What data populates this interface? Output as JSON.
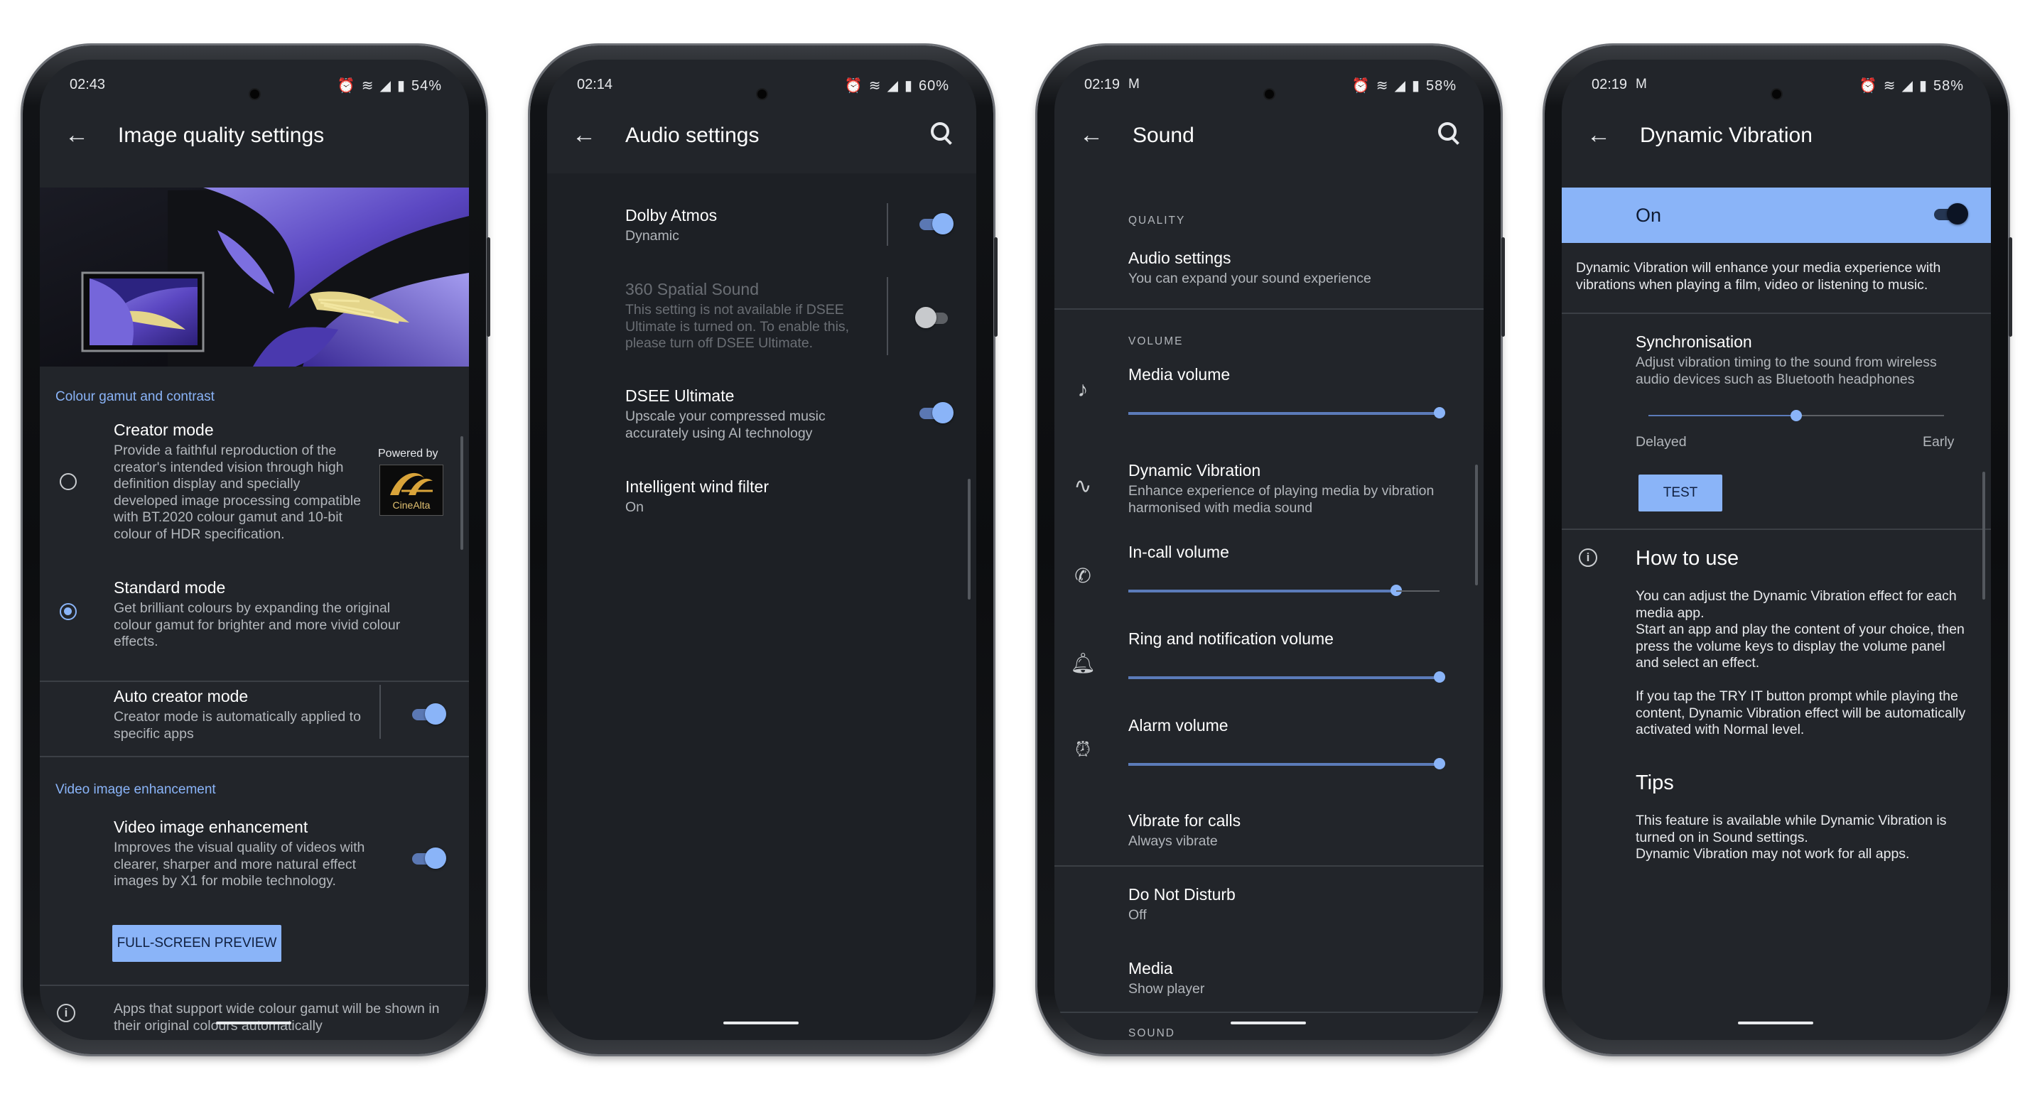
{
  "screens": [
    {
      "status": {
        "time": "02:43",
        "battery": "54%"
      },
      "title": "Image quality settings",
      "cat1": "Colour gamut and contrast",
      "creator_title": "Creator mode",
      "creator_desc": "Provide a faithful reproduction of the creator's intended vision through high definition display and specially developed image processing compatible with BT.2020 colour gamut and 10-bit colour of HDR specification.",
      "powered_by": "Powered by",
      "cinealta": "CineAlta",
      "standard_title": "Standard mode",
      "standard_desc": "Get brilliant colours by expanding the original colour gamut for brighter and more vivid colour effects.",
      "auto_title": "Auto creator mode",
      "auto_desc": "Creator mode is automatically applied to specific apps",
      "cat2": "Video image enhancement",
      "vie_title": "Video image enhancement",
      "vie_desc": "Improves the visual quality of videos with clearer, sharper and more natural effect images by X1 for mobile technology.",
      "preview_button": "FULL-SCREEN PREVIEW",
      "footer_note": "Apps that support wide colour gamut will be shown in their original colours automatically"
    },
    {
      "status": {
        "time": "02:14",
        "battery": "60%"
      },
      "title": "Audio settings",
      "dolby_title": "Dolby Atmos",
      "dolby_sub": "Dynamic",
      "spatial_title": "360 Spatial Sound",
      "spatial_desc": "This setting is not available if DSEE Ultimate is turned on. To enable this, please turn off DSEE Ultimate.",
      "dsee_title": "DSEE Ultimate",
      "dsee_desc": "Upscale your compressed music accurately using AI technology",
      "wind_title": "Intelligent wind filter",
      "wind_sub": "On"
    },
    {
      "status": {
        "time": "02:19",
        "battery": "58%"
      },
      "title": "Sound",
      "quality_cap": "QUALITY",
      "audio_title": "Audio settings",
      "audio_sub": "You can expand your sound experience",
      "volume_cap": "VOLUME",
      "media_vol": "Media volume",
      "dv_title": "Dynamic Vibration",
      "dv_sub": "Enhance experience of playing media by vibration harmonised with media sound",
      "incall_vol": "In-call volume",
      "ring_vol": "Ring and notification volume",
      "alarm_vol": "Alarm volume",
      "vibrate_title": "Vibrate for calls",
      "vibrate_sub": "Always vibrate",
      "dnd_title": "Do Not Disturb",
      "dnd_sub": "Off",
      "media_title": "Media",
      "media_sub": "Show player",
      "sound_cap": "SOUND",
      "levels": {
        "media": 1.0,
        "incall": 0.86,
        "ring": 1.0,
        "alarm": 1.0
      }
    },
    {
      "status": {
        "time": "02:19",
        "battery": "58%"
      },
      "title": "Dynamic Vibration",
      "on_label": "On",
      "intro": "Dynamic Vibration will enhance your media experience with vibrations when playing a film, video or listening to music.",
      "sync_title": "Synchronisation",
      "sync_desc": "Adjust vibration timing to the sound from wireless audio devices such as Bluetooth headphones",
      "delayed": "Delayed",
      "early": "Early",
      "sync_level": 0.5,
      "test_button": "TEST",
      "how_title": "How to use",
      "how_p1": "You can adjust the Dynamic Vibration effect for each media app.",
      "how_p2": "Start an app and play the content of your choice, then press the volume keys to display the volume panel and select an effect.",
      "how_p3": "If you tap the TRY IT button prompt while playing the content, Dynamic Vibration effect will be automatically activated with Normal level.",
      "tips_title": "Tips",
      "tips_p1": "This feature is available while Dynamic Vibration is turned on in Sound settings.",
      "tips_p2": "Dynamic Vibration may not work for all apps."
    }
  ],
  "colors": {
    "accent": "#8ab4f8",
    "background": "#22252a",
    "on_bar": "#8ab4f8"
  }
}
